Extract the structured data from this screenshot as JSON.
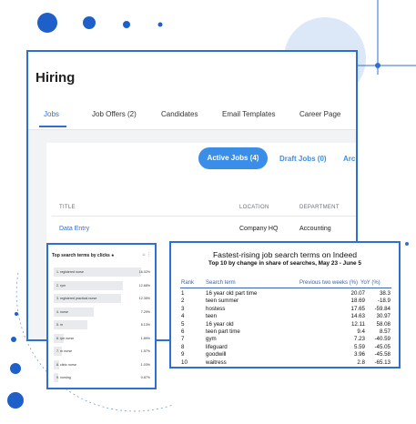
{
  "hiring": {
    "title": "Hiring",
    "tabs": [
      "Jobs",
      "Job Offers (2)",
      "Candidates",
      "Email Templates",
      "Career Page"
    ],
    "filters": [
      "Active Jobs (4)",
      "Draft Jobs (0)",
      "Arch"
    ],
    "columns": [
      "TITLE",
      "LOCATION",
      "DEPARTMENT"
    ],
    "row": {
      "title": "Data Entry",
      "location": "Company HQ",
      "department": "Accounting"
    }
  },
  "clicks_widget": {
    "title": "Top search terms by clicks",
    "rows": [
      {
        "rank": "1.",
        "term": "registered nurse",
        "pct": "16.02%",
        "share": 16.02
      },
      {
        "rank": "2.",
        "term": "rym",
        "pct": "12.68%",
        "share": 12.68
      },
      {
        "rank": "3.",
        "term": "registered practical nurse",
        "pct": "12.35%",
        "share": 12.35
      },
      {
        "rank": "4.",
        "term": "nurse",
        "pct": "7.29%",
        "share": 7.29
      },
      {
        "rank": "5.",
        "term": "rn",
        "pct": "6.13%",
        "share": 6.13
      },
      {
        "rank": "6.",
        "term": "rpn nurse",
        "pct": "1.89%",
        "share": 1.89
      },
      {
        "rank": "7.",
        "term": "rn nurse",
        "pct": "1.57%",
        "share": 1.57
      },
      {
        "rank": "8.",
        "term": "clinic nurse",
        "pct": "1.03%",
        "share": 1.03
      },
      {
        "rank": "9.",
        "term": "nursing",
        "pct": "0.87%",
        "share": 0.87
      }
    ]
  },
  "indeed": {
    "title": "Fastest-rising job search terms on Indeed",
    "subtitle": "Top 10 by change in share of searches, May 23 - June 5",
    "columns": [
      "Rank",
      "Search term",
      "Previous two weeks (%)",
      "YoY (%)"
    ],
    "rows": [
      [
        "1",
        "16 year old part time",
        "20.07",
        "38.3"
      ],
      [
        "2",
        "teen summer",
        "18.69",
        "-18.9"
      ],
      [
        "3",
        "hostess",
        "17.65",
        "-59.84"
      ],
      [
        "4",
        "teen",
        "14.63",
        "30.97"
      ],
      [
        "5",
        "16 year old",
        "12.11",
        "58.08"
      ],
      [
        "6",
        "teen part time",
        "9.4",
        "8.57"
      ],
      [
        "7",
        "gym",
        "7.23",
        "-40.59"
      ],
      [
        "8",
        "lifeguard",
        "5.59",
        "-45.05"
      ],
      [
        "9",
        "goodwill",
        "3.96",
        "-45.58"
      ],
      [
        "10",
        "waitress",
        "2.8",
        "-65.13"
      ]
    ]
  },
  "colors": {
    "accent": "#2e6fd2",
    "dots": "#1f5fc9",
    "pill": "#3b8ee8"
  }
}
